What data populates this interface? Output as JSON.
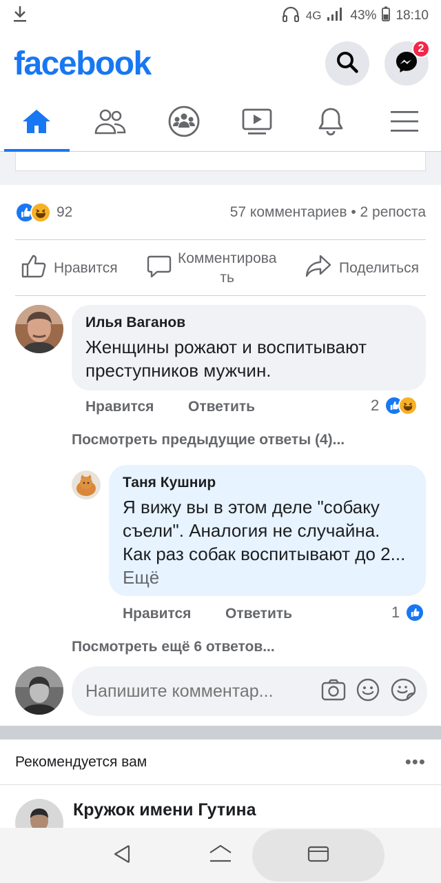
{
  "status": {
    "network": "4G",
    "battery": "43%",
    "time": "18:10"
  },
  "header": {
    "logo": "facebook",
    "messenger_badge": "2"
  },
  "post": {
    "reaction_count": "92",
    "comments_shares": "57 комментариев • 2 репоста"
  },
  "actions": {
    "like": "Нравится",
    "comment": "Комментирова\nть",
    "share": "Поделиться"
  },
  "comments": [
    {
      "author": "Илья Ваганов",
      "text": "Женщины рожают и воспитывают преступников мужчин.",
      "like_label": "Нравится",
      "reply_label": "Ответить",
      "reaction_count": "2",
      "view_previous": "Посмотреть предыдущие ответы (4)..."
    },
    {
      "author": "Таня Кушнир",
      "text": "Я вижу вы в этом деле \"собаку съели\". Аналогия не случайна. Как раз собак воспитывают до 2...",
      "see_more": "Ещё",
      "like_label": "Нравится",
      "reply_label": "Ответить",
      "reaction_count": "1",
      "view_more": "Посмотреть ещё 6 ответов..."
    }
  ],
  "composer": {
    "placeholder": "Напишите комментар..."
  },
  "recommended": {
    "title": "Рекомендуется вам",
    "group_name": "Кружок имени Гутина"
  },
  "colors": {
    "brand": "#1877f2",
    "badge": "#f02849",
    "bubble": "#f0f2f5",
    "reply_bubble": "#e7f3ff"
  }
}
